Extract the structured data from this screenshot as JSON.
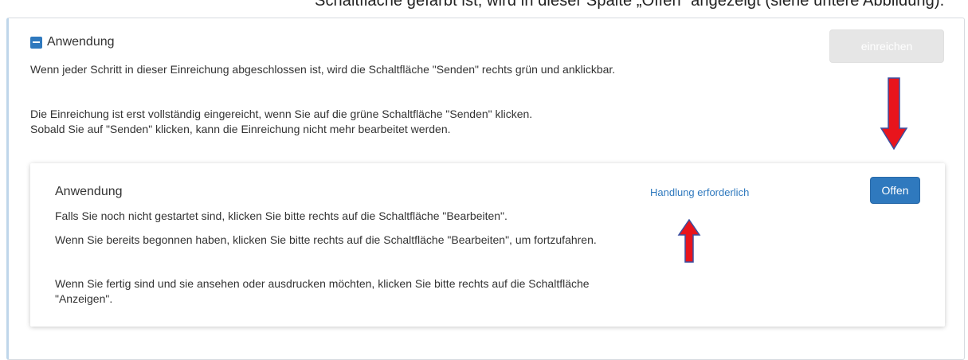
{
  "caption": {
    "text": "Schaltfläche gefärbt ist, wird in dieser Spalte „Offen“ angezeigt (siehe untere Abbildung)."
  },
  "section": {
    "title": "Anwendung",
    "intro_p1": "Wenn jeder Schritt in dieser Einreichung abgeschlossen ist, wird die Schaltfläche \"Senden\" rechts grün und anklickbar.",
    "intro_p2_line1": "Die Einreichung ist erst vollständig eingereicht, wenn Sie auf die grüne Schaltfläche \"Senden\" klicken.",
    "intro_p2_line2": "Sobald Sie auf \"Senden\" klicken, kann die Einreichung nicht mehr bearbeitet werden.",
    "submit_label": "einreichen"
  },
  "card": {
    "title": "Anwendung",
    "p1": "Falls Sie noch nicht gestartet sind, klicken Sie bitte rechts auf die Schaltfläche \"Bearbeiten\".",
    "p2": "Wenn Sie bereits begonnen haben, klicken Sie bitte rechts auf die Schaltfläche \"Bearbeiten\", um fortzufahren.",
    "p3": "Wenn Sie fertig sind und sie ansehen oder ausdrucken möchten, klicken Sie bitte rechts auf die Schaltfläche \"Anzeigen\".",
    "status_link": "Handlung erforderlich",
    "open_label": "Offen"
  },
  "colors": {
    "accent": "#2f79be",
    "arrow_fill": "#e8141c",
    "arrow_outline": "#3a4fa0",
    "disabled_button": "#e6e6e6"
  },
  "icons": {
    "section_toggle": "minus-square-icon",
    "down_arrow": "red-down-arrow-icon",
    "up_arrow": "red-up-arrow-icon"
  }
}
